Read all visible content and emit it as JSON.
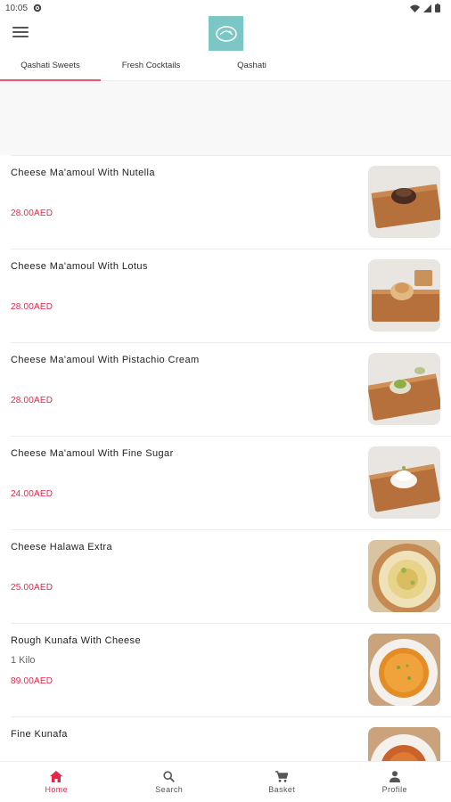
{
  "status": {
    "time": "10:05"
  },
  "tabs": [
    {
      "label": "Qashati Sweets"
    },
    {
      "label": "Fresh Cocktails"
    },
    {
      "label": "Qashati"
    }
  ],
  "items": [
    {
      "title": "Cheese Ma'amoul With Nutella",
      "subtitle": "",
      "price": "28.00AED"
    },
    {
      "title": "Cheese Ma'amoul With Lotus",
      "subtitle": "",
      "price": "28.00AED"
    },
    {
      "title": "Cheese Ma'amoul With Pistachio Cream",
      "subtitle": "",
      "price": "28.00AED"
    },
    {
      "title": "Cheese Ma'amoul With Fine Sugar",
      "subtitle": "",
      "price": "24.00AED"
    },
    {
      "title": "Cheese Halawa Extra",
      "subtitle": "",
      "price": "25.00AED"
    },
    {
      "title": "Rough Kunafa With Cheese",
      "subtitle": "1 Kilo",
      "price": "89.00AED"
    },
    {
      "title": "Fine Kunafa",
      "subtitle": "",
      "price": ""
    }
  ],
  "nav": {
    "home": "Home",
    "search": "Search",
    "basket": "Basket",
    "profile": "Profile"
  },
  "colors": {
    "accent": "#e8264a",
    "tab_indicator": "#e8586b",
    "logo_bg": "#7cc7c6"
  }
}
